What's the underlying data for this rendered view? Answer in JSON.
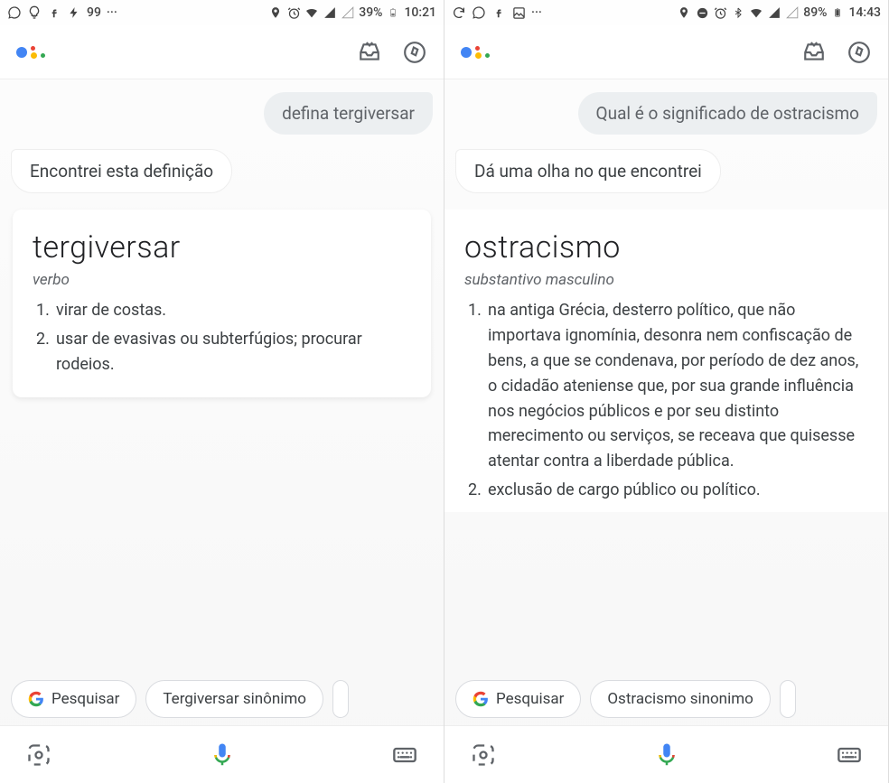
{
  "screens": [
    {
      "status": {
        "battery_pct": "39%",
        "time": "10:21",
        "counter": "99"
      },
      "user_query": "defina tergiversar",
      "assistant_reply": "Encontrei esta definição",
      "card": {
        "word": "tergiversar",
        "pos": "verbo",
        "definitions": [
          "virar de costas.",
          "usar de evasivas ou subterfúgios; procurar rodeios."
        ]
      },
      "chips": {
        "search_label": "Pesquisar",
        "synonym_label": "Tergiversar sinônimo"
      }
    },
    {
      "status": {
        "battery_pct": "89%",
        "time": "14:43",
        "counter": ""
      },
      "user_query": "Qual é o significado de ostracismo",
      "assistant_reply": "Dá uma olha no que encontrei",
      "card": {
        "word": "ostracismo",
        "pos": "substantivo masculino",
        "definitions": [
          "na antiga Grécia, desterro político, que não importava ignomínia, desonra nem confiscação de bens, a que se condenava, por período de dez anos, o cidadão ateniense que, por sua grande influência nos negócios públicos e por seu distinto merecimento ou serviços, se receava que quisesse atentar contra a liberdade pública.",
          "exclusão de cargo público ou político."
        ]
      },
      "chips": {
        "search_label": "Pesquisar",
        "synonym_label": "Ostracismo sinonimo"
      }
    }
  ]
}
